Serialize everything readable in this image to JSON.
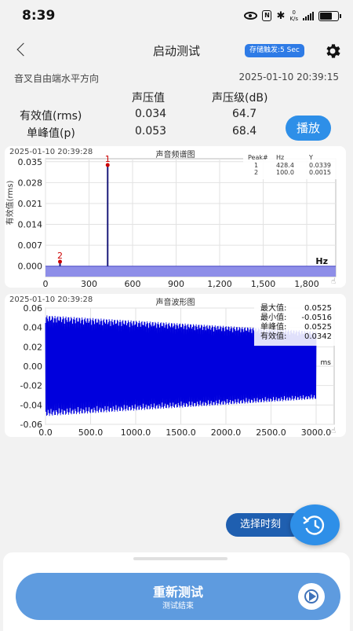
{
  "status_bar": {
    "time": "8:39",
    "net_speed_value": "0",
    "net_speed_unit": "K/s"
  },
  "header": {
    "title": "启动测试",
    "save_badge": "存储触发:5 Sec"
  },
  "info": {
    "location": "音叉自由端水平方向",
    "datetime": "2025-01-10 20:39:15"
  },
  "measurements": {
    "headers": [
      "声压值",
      "声压级(dB)"
    ],
    "rows": [
      {
        "label": "有效值(rms)",
        "value": "0.034",
        "level": "64.7"
      },
      {
        "label": "单峰值(p)",
        "value": "0.053",
        "level": "68.4"
      }
    ]
  },
  "play_button": "播放",
  "spectrum": {
    "datetime": "2025-01-10 20:39:28",
    "title": "声音频谱图",
    "peak_table": {
      "headers": [
        "Peak#",
        "Hz",
        "Y"
      ],
      "rows": [
        [
          "1",
          "428.4",
          "0.0339"
        ],
        [
          "2",
          "100.0",
          "0.0015"
        ]
      ]
    }
  },
  "waveform": {
    "datetime": "2025-01-10 20:39:28",
    "title": "声音波形图",
    "stats": [
      {
        "label": "最大值:",
        "value": "0.0525"
      },
      {
        "label": "最小值:",
        "value": "-0.0516"
      },
      {
        "label": "单峰值:",
        "value": "0.0525"
      },
      {
        "label": "有效值:",
        "value": "0.0342"
      }
    ],
    "unit_label": "ms"
  },
  "fab": {
    "select_time": "选择时刻"
  },
  "bottom": {
    "main": "重新测试",
    "sub": "测试结束"
  },
  "colors": {
    "accent": "#2e8fe8",
    "spectrum_fill": "#8e8ee8",
    "wave": "#0000dd",
    "peak_line": "#1a1a7a"
  },
  "chart_data": [
    {
      "type": "line",
      "ylabel": "有效值(rms)",
      "xlabel": "Hz",
      "x_ticks": [
        0,
        300,
        600,
        900,
        1200,
        1500,
        1800
      ],
      "x_tick_labels": [
        "0",
        "300",
        "600",
        "900",
        "1,200",
        "1,500",
        "1,800"
      ],
      "y_ticks": [
        0.0,
        0.007,
        0.014,
        0.021,
        0.028,
        0.035
      ],
      "y_tick_labels": [
        "0.000",
        "0.007",
        "0.014",
        "0.021",
        "0.028",
        "0.035"
      ],
      "xlim": [
        0,
        2000
      ],
      "ylim": [
        -0.0035,
        0.036
      ],
      "grid": true,
      "peaks": [
        {
          "label": "1",
          "x": 428.4,
          "y": 0.0339
        },
        {
          "label": "2",
          "x": 100.0,
          "y": 0.0015
        }
      ]
    },
    {
      "type": "area",
      "x_ticks": [
        0,
        500,
        1000,
        1500,
        2000,
        2500,
        3000
      ],
      "x_tick_labels": [
        "0.0",
        "500.0",
        "1000.0",
        "1500.0",
        "2000.0",
        "2500.0",
        "3000.0"
      ],
      "y_ticks": [
        -0.06,
        -0.04,
        -0.02,
        0.0,
        0.02,
        0.04,
        0.06
      ],
      "y_tick_labels": [
        "-0.06",
        "-0.04",
        "-0.02",
        "0.00",
        "0.02",
        "0.04",
        "0.06"
      ],
      "xlim": [
        0,
        3200
      ],
      "ylim": [
        -0.06,
        0.06
      ],
      "grid": true,
      "envelope": {
        "x": [
          0,
          3000
        ],
        "upper": [
          0.0525,
          0.036
        ],
        "lower": [
          -0.0516,
          -0.034
        ]
      }
    }
  ]
}
